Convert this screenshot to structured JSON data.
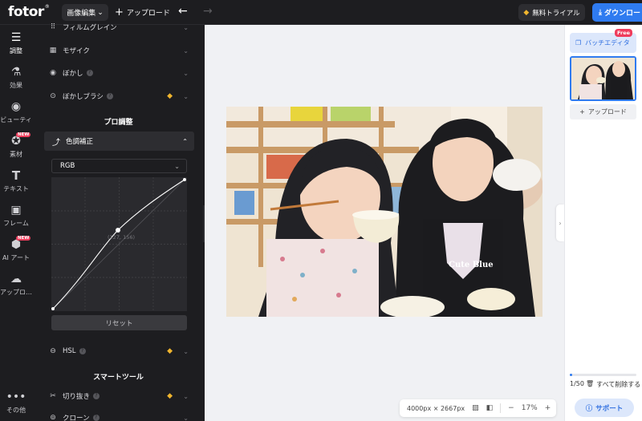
{
  "app": {
    "logo": "fotor"
  },
  "topbar": {
    "image_edit_label": "画像編集",
    "upload_label": "アップロード",
    "trial_label": "無料トライアル",
    "download_label": "ダウンロー"
  },
  "leftnav": {
    "items": [
      {
        "label": "調整",
        "icon": "sliders-icon",
        "active": true
      },
      {
        "label": "効果",
        "icon": "flask-icon"
      },
      {
        "label": "ビューティ",
        "icon": "eye-icon"
      },
      {
        "label": "素材",
        "icon": "star-icon",
        "badge": "NEW"
      },
      {
        "label": "テキスト",
        "icon": "text-icon"
      },
      {
        "label": "フレーム",
        "icon": "frame-icon"
      },
      {
        "label": "AI アート",
        "icon": "ai-art-icon",
        "badge": "NEW"
      },
      {
        "label": "アップロ…",
        "icon": "cloud-upload-icon"
      },
      {
        "label": "その他",
        "icon": "more-icon"
      }
    ]
  },
  "panel": {
    "film_grain": "フィルムグレイン",
    "mosaic": "モザイク",
    "blur": "ぼかし",
    "blur_brush": "ぼかしブラシ",
    "pro_title": "プロ調整",
    "curves": "色調補正",
    "channel": "RGB",
    "point_label": "(127, 156)",
    "reset": "リセット",
    "hsl": "HSL",
    "smart_title": "スマートツール",
    "crop": "切り抜き",
    "clone": "クローン"
  },
  "canvas": {
    "dimensions": "4000px × 2667px",
    "zoom": "17%"
  },
  "rightpanel": {
    "batch_label": "バッチエディタ",
    "free_badge": "Free",
    "upload_label": "アップロード",
    "count": "1/50",
    "delete_all": "すべて削除する",
    "support": "サポート",
    "progress": 0.02
  },
  "photo": {
    "shirt_text": "Cute Blue"
  },
  "colors": {
    "accent": "#2f7bf0",
    "badge": "#ef3d5c",
    "gem": "#f0b52e"
  }
}
